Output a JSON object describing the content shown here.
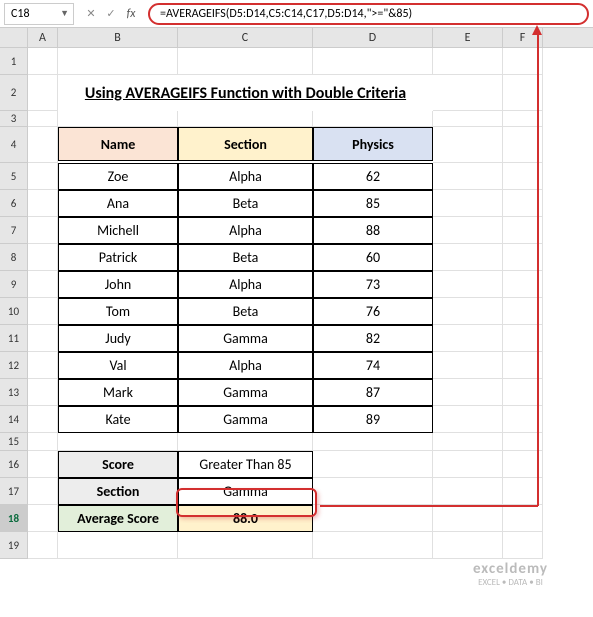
{
  "name_box": "C18",
  "formula": "=AVERAGEIFS(D5:D14,C5:C14,C17,D5:D14,\">=\"&85)",
  "columns": [
    "A",
    "B",
    "C",
    "D",
    "E",
    "F"
  ],
  "row_numbers": [
    "1",
    "2",
    "3",
    "4",
    "5",
    "6",
    "7",
    "8",
    "9",
    "10",
    "11",
    "12",
    "13",
    "14",
    "15",
    "16",
    "17",
    "18",
    "19"
  ],
  "title": "Using AVERAGEIFS Function with Double Criteria",
  "headers": {
    "name": "Name",
    "section": "Section",
    "physics": "Physics"
  },
  "chart_data": {
    "type": "table",
    "columns": [
      "Name",
      "Section",
      "Physics"
    ],
    "rows": [
      [
        "Zoe",
        "Alpha",
        62
      ],
      [
        "Ana",
        "Beta",
        85
      ],
      [
        "Michell",
        "Alpha",
        88
      ],
      [
        "Patrick",
        "Beta",
        60
      ],
      [
        "John",
        "Alpha",
        73
      ],
      [
        "Tom",
        "Beta",
        76
      ],
      [
        "Judy",
        "Gamma",
        82
      ],
      [
        "Val",
        "Alpha",
        74
      ],
      [
        "Mark",
        "Gamma",
        87
      ],
      [
        "Kate",
        "Gamma",
        89
      ]
    ]
  },
  "summary": {
    "score_label": "Score",
    "score_value": "Greater Than 85",
    "section_label": "Section",
    "section_value": "Gamma",
    "avg_label": "Average Score",
    "avg_value": "88.0"
  },
  "watermark": {
    "main": "exceldemy",
    "sub": "EXCEL • DATA • BI"
  }
}
